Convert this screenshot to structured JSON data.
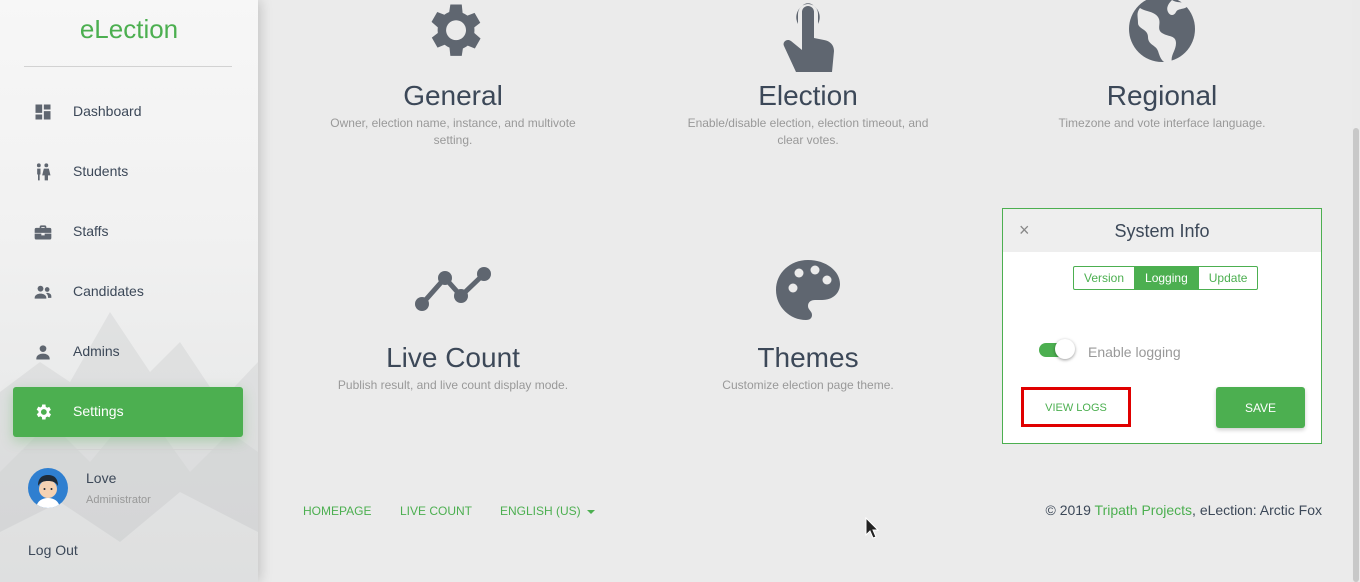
{
  "sidebar": {
    "brand": "eLection",
    "items": [
      {
        "label": "Dashboard",
        "icon": "dashboard-icon"
      },
      {
        "label": "Students",
        "icon": "students-icon"
      },
      {
        "label": "Staffs",
        "icon": "briefcase-icon"
      },
      {
        "label": "Candidates",
        "icon": "people-icon"
      },
      {
        "label": "Admins",
        "icon": "person-icon"
      },
      {
        "label": "Settings",
        "icon": "gear-icon",
        "active": true
      }
    ],
    "user": {
      "name": "Love",
      "role": "Administrator"
    },
    "logout": "Log Out"
  },
  "tiles": [
    {
      "title": "General",
      "desc": "Owner, election name, instance, and multivote setting.",
      "icon": "gear-icon"
    },
    {
      "title": "Election",
      "desc": "Enable/disable election, election timeout, and clear votes.",
      "icon": "touch-icon"
    },
    {
      "title": "Regional",
      "desc": "Timezone and vote interface language.",
      "icon": "globe-icon"
    },
    {
      "title": "Live Count",
      "desc": "Publish result, and live count display mode.",
      "icon": "chart-line-icon"
    },
    {
      "title": "Themes",
      "desc": "Customize election page theme.",
      "icon": "palette-icon"
    }
  ],
  "system_info": {
    "title": "System Info",
    "close": "×",
    "tabs": [
      "Version",
      "Logging",
      "Update"
    ],
    "active_tab": "Logging",
    "toggle_label": "Enable logging",
    "toggle_on": true,
    "view_logs": "VIEW LOGS",
    "save": "SAVE"
  },
  "footer": {
    "links": [
      "HOMEPAGE",
      "LIVE COUNT",
      "ENGLISH (US)"
    ],
    "copyright_prefix": "© 2019 ",
    "copyright_link": "Tripath Projects",
    "copyright_suffix": ", eLection: Arctic Fox"
  },
  "colors": {
    "accent": "#4caf50",
    "icon": "#5f6670",
    "highlight": "#e00000"
  }
}
